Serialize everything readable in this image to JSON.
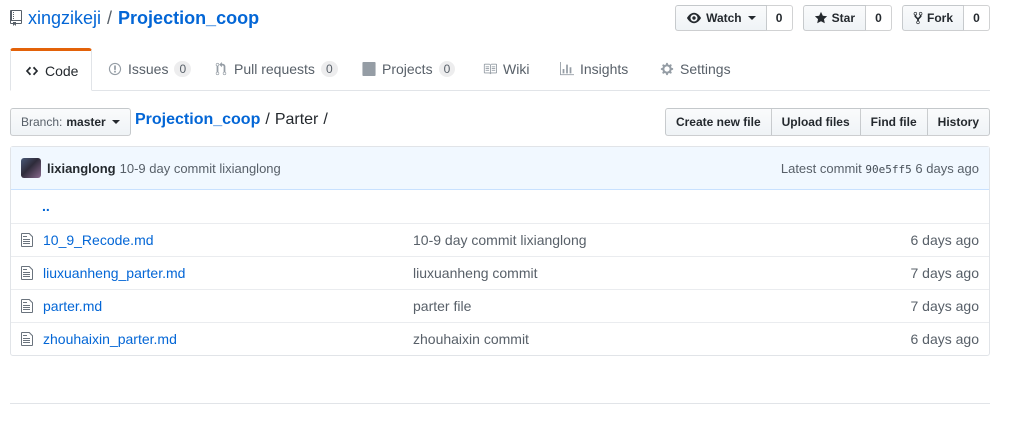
{
  "repo": {
    "owner": "xingzikeji",
    "separator": "/",
    "name": "Projection_coop"
  },
  "actions": {
    "watch": {
      "label": "Watch",
      "count": "0"
    },
    "star": {
      "label": "Star",
      "count": "0"
    },
    "fork": {
      "label": "Fork",
      "count": "0"
    }
  },
  "tabs": {
    "code": {
      "label": "Code"
    },
    "issues": {
      "label": "Issues",
      "count": "0"
    },
    "pulls": {
      "label": "Pull requests",
      "count": "0"
    },
    "projects": {
      "label": "Projects",
      "count": "0"
    },
    "wiki": {
      "label": "Wiki"
    },
    "insights": {
      "label": "Insights"
    },
    "settings": {
      "label": "Settings"
    }
  },
  "branch": {
    "prefix": "Branch:",
    "name": "master"
  },
  "breadcrumb": {
    "root": "Projection_coop",
    "sep": "/",
    "current": "Parter",
    "trail": "/"
  },
  "file_actions": [
    "Create new file",
    "Upload files",
    "Find file",
    "History"
  ],
  "latest_commit": {
    "author": "lixianglong",
    "message": "10-9 day commit lixianglong",
    "label": "Latest commit",
    "sha": "90e5ff5",
    "age": "6 days ago"
  },
  "up_dir": "..",
  "files": [
    {
      "name": "10_9_Recode.md",
      "message": "10-9 day commit lixianglong",
      "age": "6 days ago"
    },
    {
      "name": "liuxuanheng_parter.md",
      "message": "liuxuanheng commit",
      "age": "7 days ago"
    },
    {
      "name": "parter.md",
      "message": "parter file",
      "age": "7 days ago"
    },
    {
      "name": "zhouhaixin_parter.md",
      "message": "zhouhaixin commit",
      "age": "6 days ago"
    }
  ],
  "colors": {
    "link": "#0366d6",
    "tab_accent": "#e36209",
    "commit_bg": "#f1f8ff"
  }
}
